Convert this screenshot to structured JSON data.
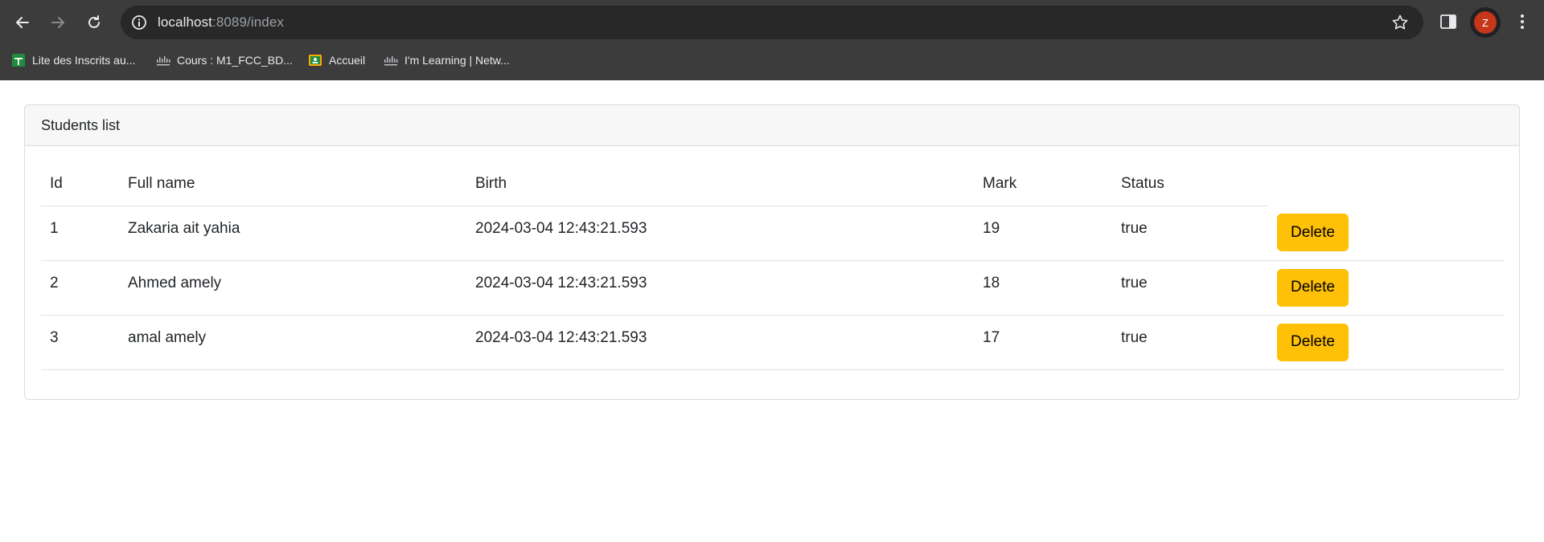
{
  "browser": {
    "url_host": "localhost",
    "url_path": ":8089/index",
    "profile_initial": "Z",
    "bookmarks": [
      {
        "label": "Lite des Inscrits au...",
        "icon": "sheets-icon"
      },
      {
        "label": "Cours : M1_FCC_BD...",
        "icon": "cisco-icon"
      },
      {
        "label": "Accueil",
        "icon": "classroom-icon"
      },
      {
        "label": "I'm Learning | Netw...",
        "icon": "cisco-icon"
      }
    ]
  },
  "page": {
    "card_title": "Students list",
    "columns": [
      "Id",
      "Full name",
      "Birth",
      "Mark",
      "Status"
    ],
    "rows": [
      {
        "id": "1",
        "name": "Zakaria ait yahia",
        "birth": "2024-03-04 12:43:21.593",
        "mark": "19",
        "status": "true",
        "action": "Delete"
      },
      {
        "id": "2",
        "name": "Ahmed amely",
        "birth": "2024-03-04 12:43:21.593",
        "mark": "18",
        "status": "true",
        "action": "Delete"
      },
      {
        "id": "3",
        "name": "amal amely",
        "birth": "2024-03-04 12:43:21.593",
        "mark": "17",
        "status": "true",
        "action": "Delete"
      }
    ]
  },
  "colors": {
    "chrome_bg": "#3c3c3c",
    "delete_button": "#ffc107",
    "profile_avatar": "#c5361b"
  }
}
